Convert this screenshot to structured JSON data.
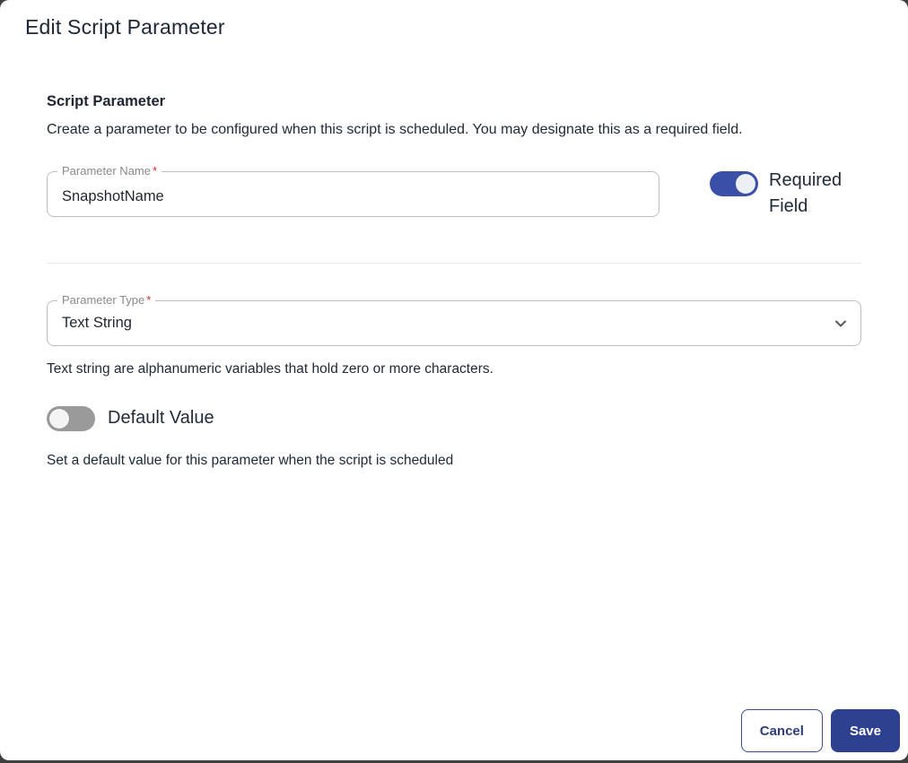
{
  "dialog": {
    "title": "Edit Script Parameter",
    "section": {
      "heading": "Script Parameter",
      "description": "Create a parameter to be configured when this script is scheduled. You may designate this as a required field."
    },
    "param_name": {
      "label": "Parameter Name",
      "required_marker": "*",
      "value": "SnapshotName"
    },
    "required_toggle": {
      "label": "Required Field",
      "state": "on"
    },
    "param_type": {
      "label": "Parameter Type",
      "required_marker": "*",
      "value": "Text String",
      "helper": "Text string are alphanumeric variables that hold zero or more characters."
    },
    "default_toggle": {
      "label": "Default Value",
      "state": "off",
      "helper": "Set a default value for this parameter when the script is scheduled"
    },
    "footer": {
      "cancel_label": "Cancel",
      "save_label": "Save"
    },
    "colors": {
      "accent": "#3a4fa8",
      "save_button": "#2e4190",
      "required_asterisk": "#d32f2f"
    }
  }
}
